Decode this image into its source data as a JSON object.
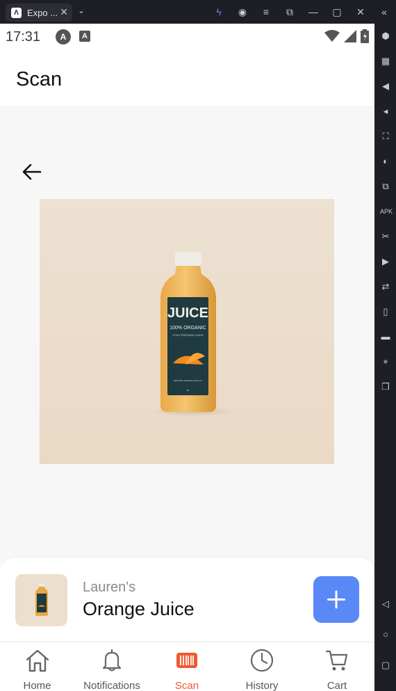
{
  "window": {
    "tab_title": "Expo ...",
    "logo": "expo-logo",
    "icons": [
      "lightning-icon",
      "account-icon",
      "menu-icon",
      "popout-icon",
      "minimize-icon",
      "maximize-icon",
      "close-icon",
      "collapse-icon"
    ]
  },
  "status_bar": {
    "time": "17:31",
    "badge_a": "A",
    "badge_b": "A"
  },
  "header": {
    "title": "Scan"
  },
  "scan": {
    "image": "orange-juice-bottle-photo"
  },
  "product_card": {
    "brand": "Lauren's",
    "name": "Orange Juice",
    "add_icon": "plus-icon",
    "accent": "#5a88f6"
  },
  "tabbar": {
    "active_color": "#ee5a2f",
    "items": [
      {
        "label": "Home",
        "icon": "home-icon"
      },
      {
        "label": "Notifications",
        "icon": "bell-icon"
      },
      {
        "label": "Scan",
        "icon": "scan-barcode-icon"
      },
      {
        "label": "History",
        "icon": "history-icon"
      },
      {
        "label": "Cart",
        "icon": "cart-icon"
      }
    ]
  },
  "side_rail": {
    "icons": [
      "settings-icon",
      "keyboard-icon",
      "volume-up-icon",
      "volume-down-icon",
      "screenshot-icon",
      "rotate-icon",
      "multi-window-icon",
      "apk-install-icon",
      "cut-icon",
      "record-icon",
      "sync-icon",
      "shake-icon",
      "folder-icon",
      "location-icon",
      "copy-icon",
      "back-nav-icon",
      "home-nav-icon",
      "recents-nav-icon"
    ]
  }
}
